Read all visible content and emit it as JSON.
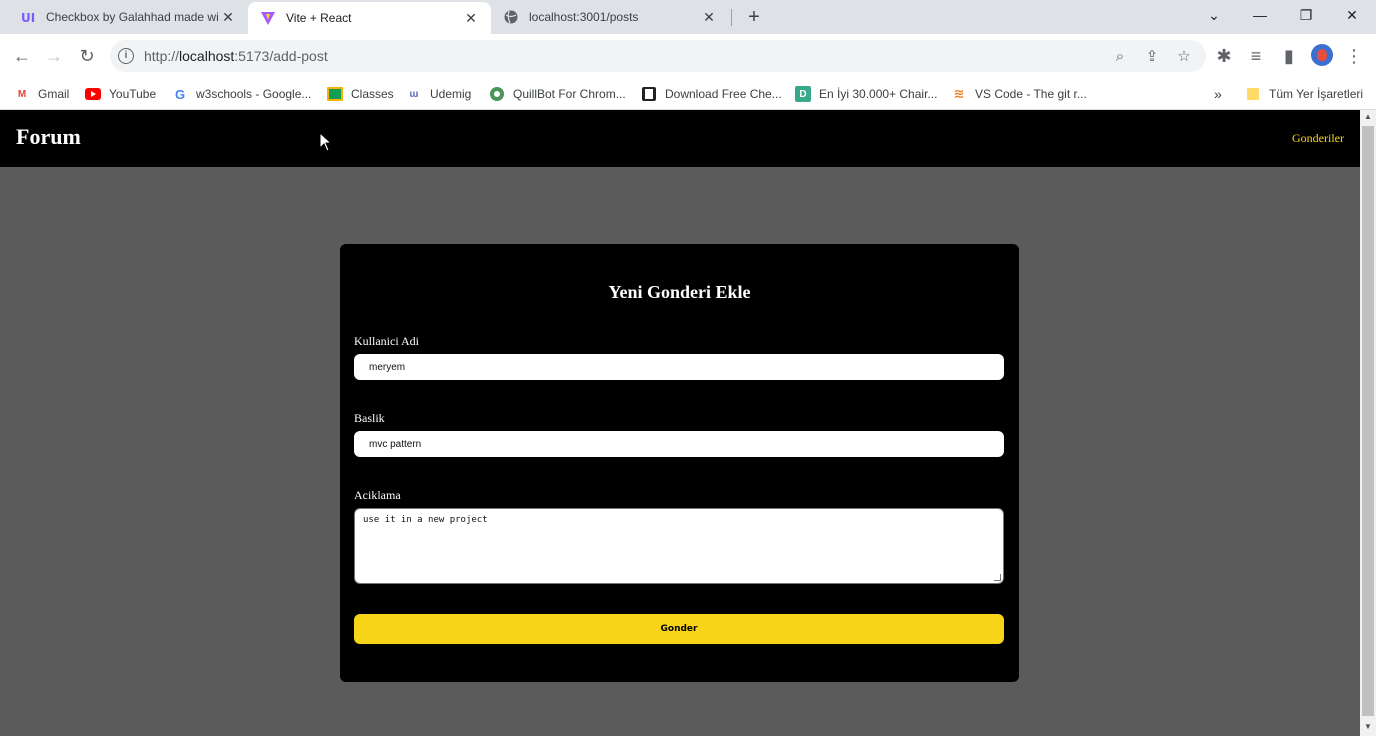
{
  "browser": {
    "tabs": [
      {
        "title": "Checkbox by Galahhad made wi",
        "favicon": "uiverse-icon",
        "active": false
      },
      {
        "title": "Vite + React",
        "favicon": "vite-icon",
        "active": true
      },
      {
        "title": "localhost:3001/posts",
        "favicon": "globe-icon",
        "active": false
      }
    ],
    "url_prefix": "http://",
    "url_host": "localhost",
    "url_rest": ":5173/add-post",
    "bookmarks": [
      {
        "label": "Gmail",
        "icon": "gmail-icon"
      },
      {
        "label": "YouTube",
        "icon": "youtube-icon"
      },
      {
        "label": "w3schools - Google...",
        "icon": "google-icon"
      },
      {
        "label": "Classes",
        "icon": "classroom-icon"
      },
      {
        "label": "Udemig",
        "icon": "udemig-icon"
      },
      {
        "label": "QuillBot For Chrom...",
        "icon": "quillbot-icon"
      },
      {
        "label": "Download Free Che...",
        "icon": "bookmark-icon"
      },
      {
        "label": "En İyi 30.000+ Chair...",
        "icon": "d-icon"
      },
      {
        "label": "VS Code - The git r...",
        "icon": "stackoverflow-icon"
      }
    ],
    "bookmarks_overflow": "»",
    "all_bookmarks": "Tüm Yer İşaretleri"
  },
  "navbar": {
    "logo": "Forum",
    "link": "Gonderiler"
  },
  "form": {
    "title": "Yeni Gonderi Ekle",
    "username_label": "Kullanici Adi",
    "username_value": "meryem",
    "title_label": "Baslik",
    "title_value": "mvc pattern",
    "description_label": "Aciklama",
    "description_value": "use it in a new project",
    "submit_label": "Gonder"
  },
  "colors": {
    "accent": "#f7d417",
    "page_bg": "#5b5b5b",
    "card_bg": "#000000"
  }
}
